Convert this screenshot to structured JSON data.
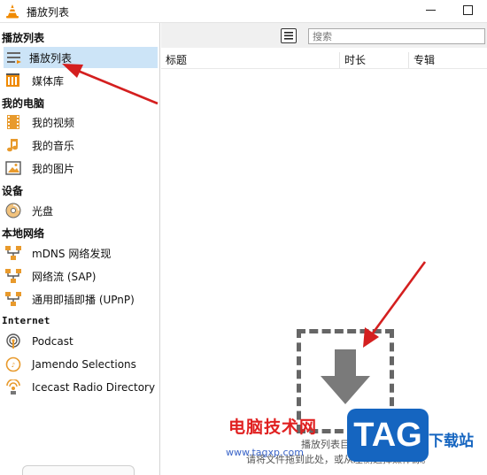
{
  "window": {
    "title": "播放列表",
    "app_icon": "vlc-cone-icon"
  },
  "sidebar": {
    "sections": [
      {
        "title": "播放列表",
        "items": [
          {
            "label": "播放列表",
            "icon": "playlist-icon",
            "selected": true
          },
          {
            "label": "媒体库",
            "icon": "media-library-icon"
          }
        ]
      },
      {
        "title": "我的电脑",
        "items": [
          {
            "label": "我的视频",
            "icon": "film-icon"
          },
          {
            "label": "我的音乐",
            "icon": "music-note-icon"
          },
          {
            "label": "我的图片",
            "icon": "picture-icon"
          }
        ]
      },
      {
        "title": "设备",
        "items": [
          {
            "label": "光盘",
            "icon": "disc-icon"
          }
        ]
      },
      {
        "title": "本地网络",
        "items": [
          {
            "label": "mDNS 网络发现",
            "icon": "network-icon"
          },
          {
            "label": "网络流 (SAP)",
            "icon": "network-icon"
          },
          {
            "label": "通用即插即播 (UPnP)",
            "icon": "network-icon"
          }
        ]
      },
      {
        "title": "Internet",
        "items": [
          {
            "label": "Podcast",
            "icon": "podcast-icon"
          },
          {
            "label": "Jamendo Selections",
            "icon": "jamendo-icon"
          },
          {
            "label": "Icecast Radio Directory",
            "icon": "icecast-icon"
          }
        ]
      }
    ]
  },
  "toolbar": {
    "search_placeholder": "搜索"
  },
  "table": {
    "columns": [
      "标题",
      "时长",
      "专辑"
    ]
  },
  "drop_zone": {
    "text_line1": "播放列表目前为空",
    "text_line2": "请将文件拖到此处，或从左侧选择媒体源。"
  },
  "watermark": {
    "site_cn": "电脑技术网",
    "url": "www.tagxp.com",
    "logo": "TAG",
    "logo_tail": "下载站"
  },
  "colors": {
    "selection": "#cce4f7",
    "arrow": "#d41f1f",
    "vlc_orange": "#f08a00"
  }
}
